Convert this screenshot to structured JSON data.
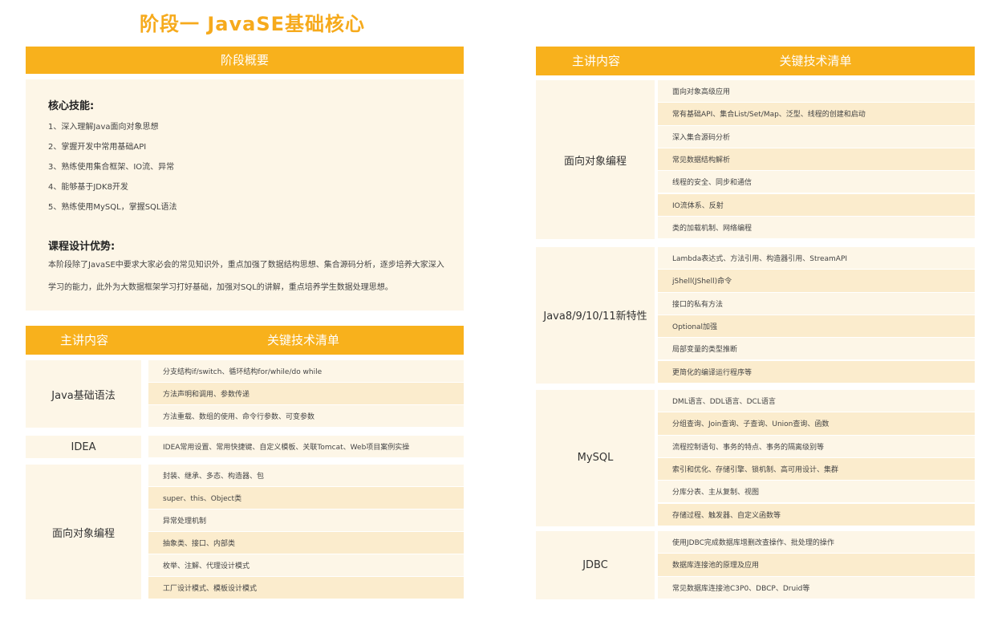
{
  "title": "阶段一  JavaSE基础核心",
  "overview": {
    "header": "阶段概要",
    "skills_title": "核心技能:",
    "skills": [
      "1、深入理解Java面向对象思想",
      "2、掌握开发中常用基础API",
      "3、熟练使用集合框架、IO流、异常",
      "4、能够基于JDK8开发",
      "5、熟练使用MySQL，掌握SQL语法"
    ],
    "advantage_title": "课程设计优势:",
    "advantage_text": "本阶段除了JavaSE中要求大家必会的常见知识外，重点加强了数据结构思想、集合源码分析，逐步培养大家深入学习的能力，此外为大数据框架学习打好基础，加强对SQL的讲解，重点培养学生数据处理思想。"
  },
  "left_table": {
    "col1": "主讲内容",
    "col2": "关键技术清单",
    "groups": [
      {
        "name": "Java基础语法",
        "items": [
          "分支结构if/switch、循环结构for/while/do while",
          "方法声明和调用、参数传递",
          "方法重载、数组的使用、命令行参数、可变参数"
        ]
      },
      {
        "name": "IDEA",
        "items": [
          "IDEA常用设置、常用快捷键、自定义模板、关联Tomcat、Web项目案例实操"
        ]
      },
      {
        "name": "面向对象编程",
        "items": [
          "封装、继承、多态、构造器、包",
          "super、this、Object类",
          "异常处理机制",
          "抽象类、接口、内部类",
          "枚举、注解、代理设计模式",
          "工厂设计模式、模板设计模式"
        ]
      }
    ]
  },
  "right_table": {
    "col1": "主讲内容",
    "col2": "关键技术清单",
    "groups": [
      {
        "name": "面向对象编程",
        "items": [
          "面向对象高级应用",
          "常有基础API、集合List/Set/Map、泛型、线程的创建和启动",
          "深入集合源码分析",
          "常见数据结构解析",
          "线程的安全、同步和通信",
          "IO流体系、反射",
          "类的加载机制、网络编程"
        ]
      },
      {
        "name": "Java8/9/10/11新特性",
        "items": [
          "Lambda表达式、方法引用、构造器引用、StreamAPI",
          "jShell(JShell)命令",
          "接口的私有方法",
          "Optional加强",
          "局部变量的类型推断",
          "更简化的编译运行程序等"
        ]
      },
      {
        "name": "MySQL",
        "items": [
          "DML语言、DDL语言、DCL语言",
          "分组查询、Join查询、子查询、Union查询、函数",
          "流程控制语句、事务的特点、事务的隔离级别等",
          "索引和优化、存储引擎、锁机制、高可用设计、集群",
          "分库分表、主从复制、视图",
          "存储过程、触发器、自定义函数等"
        ]
      },
      {
        "name": "JDBC",
        "items": [
          "使用JDBC完成数据库增删改查操作、批处理的操作",
          "数据库连接池的原理及应用",
          "常见数据库连接池C3P0、DBCP、Druid等"
        ]
      }
    ]
  }
}
